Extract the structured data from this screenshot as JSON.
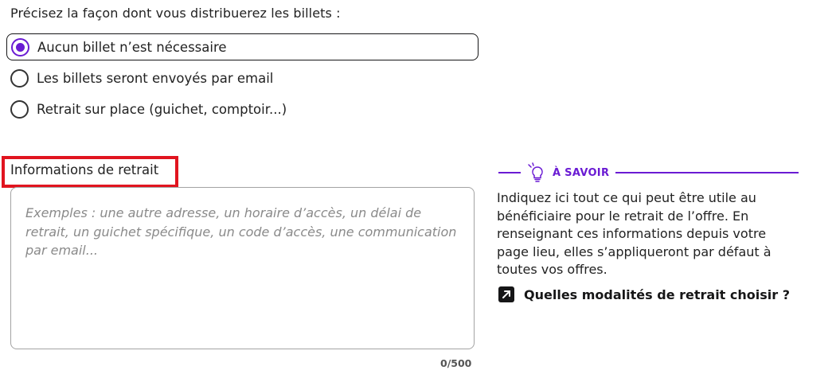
{
  "question": "Précisez la façon dont vous distribuerez les billets :",
  "options": [
    {
      "label": "Aucun billet n’est nécessaire",
      "selected": true
    },
    {
      "label": "Les billets seront envoyés par email",
      "selected": false
    },
    {
      "label": "Retrait sur place (guichet, comptoir...)",
      "selected": false
    }
  ],
  "field": {
    "label": "Informations de retrait",
    "placeholder": "Exemples : une autre adresse, un horaire d’accès, un délai de retrait, un guichet spécifique, un code d’accès, une communication par email...",
    "counter": "0/500"
  },
  "info": {
    "icon": "lightbulb-icon",
    "title": "À SAVOIR",
    "text": "Indiquez ici tout ce qui peut être utile au bénéficiaire pour le retrait de l’offre. En renseignant ces informations depuis votre page lieu, elles s’appliqueront par défaut à toutes vos offres.",
    "link_label": "Quelles modalités de retrait choisir ?",
    "link_icon": "external-arrow-icon"
  },
  "colors": {
    "accent": "#6a1bd3",
    "highlight": "#e1141f",
    "text": "#161617"
  }
}
